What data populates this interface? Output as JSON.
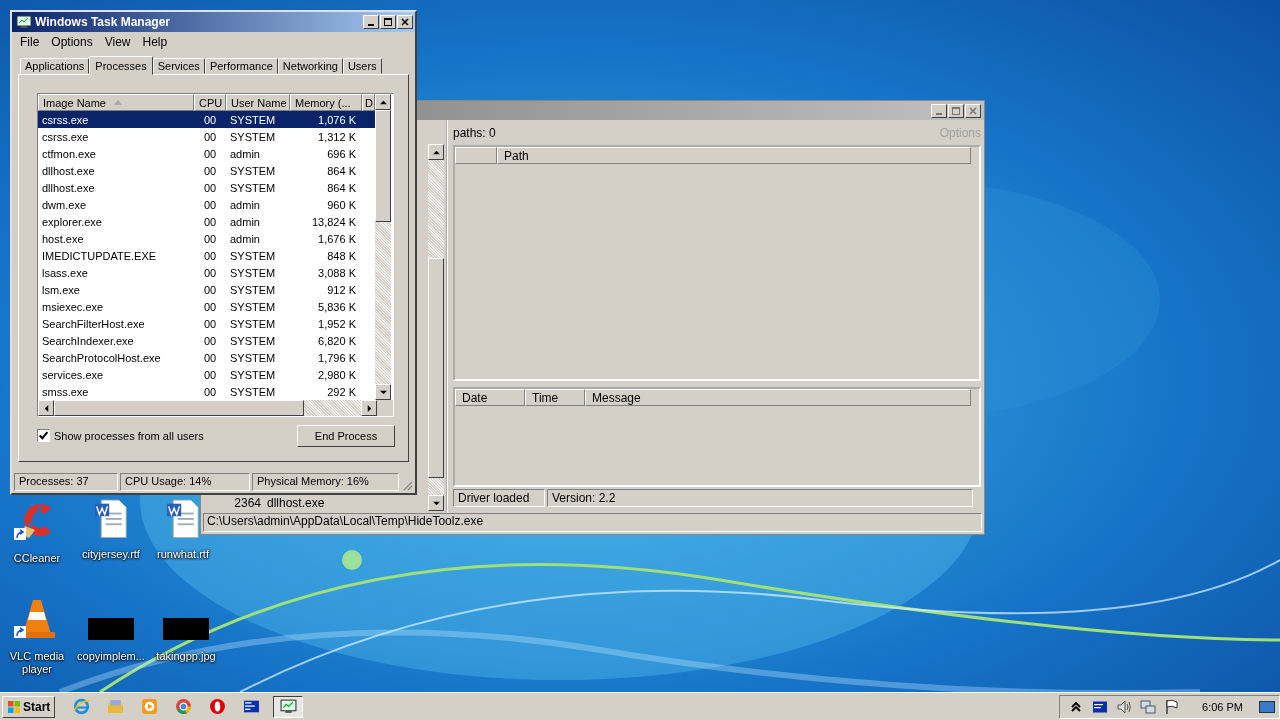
{
  "task_manager": {
    "title": "Windows Task Manager",
    "menu": [
      "File",
      "Options",
      "View",
      "Help"
    ],
    "tabs": [
      {
        "label": "Applications",
        "selected": false
      },
      {
        "label": "Processes",
        "selected": true
      },
      {
        "label": "Services",
        "selected": false
      },
      {
        "label": "Performance",
        "selected": false
      },
      {
        "label": "Networking",
        "selected": false
      },
      {
        "label": "Users",
        "selected": false
      }
    ],
    "columns": [
      "Image Name",
      "CPU",
      "User Name",
      "Memory (...",
      "D"
    ],
    "rows": [
      {
        "image_name": "csrss.exe",
        "cpu": "00",
        "user_name": "SYSTEM",
        "memory": "1,076 K",
        "selected": true
      },
      {
        "image_name": "csrss.exe",
        "cpu": "00",
        "user_name": "SYSTEM",
        "memory": "1,312 K",
        "selected": false
      },
      {
        "image_name": "ctfmon.exe",
        "cpu": "00",
        "user_name": "admin",
        "memory": "696 K",
        "selected": false
      },
      {
        "image_name": "dllhost.exe",
        "cpu": "00",
        "user_name": "SYSTEM",
        "memory": "864 K",
        "selected": false
      },
      {
        "image_name": "dllhost.exe",
        "cpu": "00",
        "user_name": "SYSTEM",
        "memory": "864 K",
        "selected": false
      },
      {
        "image_name": "dwm.exe",
        "cpu": "00",
        "user_name": "admin",
        "memory": "960 K",
        "selected": false
      },
      {
        "image_name": "explorer.exe",
        "cpu": "00",
        "user_name": "admin",
        "memory": "13,824 K",
        "selected": false
      },
      {
        "image_name": "host.exe",
        "cpu": "00",
        "user_name": "admin",
        "memory": "1,676 K",
        "selected": false
      },
      {
        "image_name": "IMEDICTUPDATE.EXE",
        "cpu": "00",
        "user_name": "SYSTEM",
        "memory": "848 K",
        "selected": false
      },
      {
        "image_name": "lsass.exe",
        "cpu": "00",
        "user_name": "SYSTEM",
        "memory": "3,088 K",
        "selected": false
      },
      {
        "image_name": "lsm.exe",
        "cpu": "00",
        "user_name": "SYSTEM",
        "memory": "912 K",
        "selected": false
      },
      {
        "image_name": "msiexec.exe",
        "cpu": "00",
        "user_name": "SYSTEM",
        "memory": "5,836 K",
        "selected": false
      },
      {
        "image_name": "SearchFilterHost.exe",
        "cpu": "00",
        "user_name": "SYSTEM",
        "memory": "1,952 K",
        "selected": false
      },
      {
        "image_name": "SearchIndexer.exe",
        "cpu": "00",
        "user_name": "SYSTEM",
        "memory": "6,820 K",
        "selected": false
      },
      {
        "image_name": "SearchProtocolHost.exe",
        "cpu": "00",
        "user_name": "SYSTEM",
        "memory": "1,796 K",
        "selected": false
      },
      {
        "image_name": "services.exe",
        "cpu": "00",
        "user_name": "SYSTEM",
        "memory": "2,980 K",
        "selected": false
      },
      {
        "image_name": "smss.exe",
        "cpu": "00",
        "user_name": "SYSTEM",
        "memory": "292 K",
        "selected": false
      }
    ],
    "show_all_users": {
      "label": "Show processes from all users",
      "checked": true
    },
    "end_process_button": "End Process",
    "status_bar": [
      "Processes: 37",
      "CPU Usage: 14%",
      "Physical Memory: 16%"
    ]
  },
  "back_window": {
    "paths_label": "paths: 0",
    "options": {
      "label": "Options",
      "disabled": true
    },
    "path_columns": [
      "Path"
    ],
    "log_columns": [
      "Date",
      "Time",
      "Message"
    ],
    "process_rows": [
      {
        "pid": "2364",
        "name": "dllhost.exe"
      }
    ],
    "status": [
      "Driver loaded",
      "Version: 2.2"
    ],
    "path_bar": "C:\\Users\\admin\\AppData\\Local\\Temp\\HideToolz.exe"
  },
  "desktop_icons": [
    {
      "label": "CCleaner",
      "kind": "ccleaner",
      "shortcut": true
    },
    {
      "label": "cityjersey.rtf",
      "kind": "document",
      "shortcut": false
    },
    {
      "label": "runwhat.rtf",
      "kind": "document",
      "shortcut": false
    },
    {
      "label": "VLC media player",
      "kind": "vlc",
      "shortcut": true
    },
    {
      "label": "copyimplem...",
      "kind": "redacted",
      "shortcut": false
    },
    {
      "label": "takingpp.jpg",
      "kind": "redacted",
      "shortcut": false
    }
  ],
  "taskbar": {
    "start": "Start",
    "apps": [
      {
        "kind": "ie",
        "active": false
      },
      {
        "kind": "folder",
        "active": false
      },
      {
        "kind": "media",
        "active": false
      },
      {
        "kind": "chrome",
        "active": false
      },
      {
        "kind": "opera",
        "active": false
      },
      {
        "kind": "bluewindow",
        "active": false
      },
      {
        "kind": "taskmanager",
        "active": true
      }
    ],
    "clock": "6:06 PM"
  }
}
